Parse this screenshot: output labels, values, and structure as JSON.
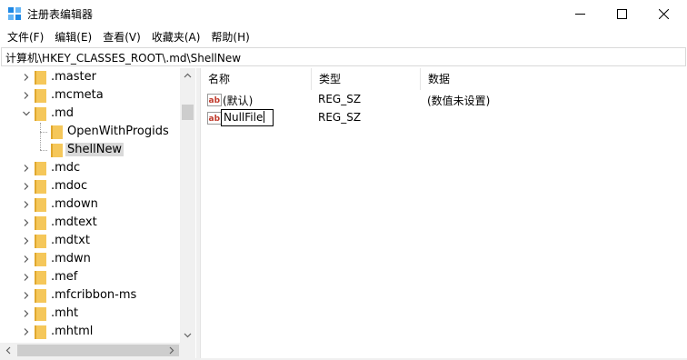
{
  "window": {
    "title": "注册表编辑器",
    "controls": [
      "minimize-icon",
      "maximize-icon",
      "close-icon"
    ]
  },
  "menu": [
    {
      "label": "文件(F)"
    },
    {
      "label": "编辑(E)"
    },
    {
      "label": "查看(V)"
    },
    {
      "label": "收藏夹(A)"
    },
    {
      "label": "帮助(H)"
    }
  ],
  "address": {
    "path": "计算机\\HKEY_CLASSES_ROOT\\.md\\ShellNew"
  },
  "tree": {
    "items": [
      {
        "label": ".master",
        "state": "collapsed",
        "level": 0
      },
      {
        "label": ".mcmeta",
        "state": "collapsed",
        "level": 0
      },
      {
        "label": ".md",
        "state": "expanded",
        "level": 0
      },
      {
        "label": "OpenWithProgids",
        "state": "leaf",
        "level": 1
      },
      {
        "label": "ShellNew",
        "state": "leaf",
        "level": 1,
        "selected": true
      },
      {
        "label": ".mdc",
        "state": "collapsed",
        "level": 0
      },
      {
        "label": ".mdoc",
        "state": "collapsed",
        "level": 0
      },
      {
        "label": ".mdown",
        "state": "collapsed",
        "level": 0
      },
      {
        "label": ".mdtext",
        "state": "collapsed",
        "level": 0
      },
      {
        "label": ".mdtxt",
        "state": "collapsed",
        "level": 0
      },
      {
        "label": ".mdwn",
        "state": "collapsed",
        "level": 0
      },
      {
        "label": ".mef",
        "state": "collapsed",
        "level": 0
      },
      {
        "label": ".mfcribbon-ms",
        "state": "collapsed",
        "level": 0
      },
      {
        "label": ".mht",
        "state": "collapsed",
        "level": 0
      },
      {
        "label": ".mhtml",
        "state": "collapsed",
        "level": 0
      }
    ]
  },
  "list": {
    "columns": [
      "名称",
      "类型",
      "数据"
    ],
    "rows": [
      {
        "name": "(默认)",
        "type": "REG_SZ",
        "data": "(数值未设置)",
        "icon": "string-value-icon"
      },
      {
        "name": "NullFile",
        "type": "REG_SZ",
        "data": "",
        "icon": "string-value-icon",
        "editing": true
      }
    ]
  },
  "colors": {
    "folder": "#f5c75a",
    "selection": "#d9d9d9",
    "ab_icon_red": "#c0392b",
    "scrollbar_track": "#f0f0f0",
    "scrollbar_thumb": "#cdcdcd"
  }
}
